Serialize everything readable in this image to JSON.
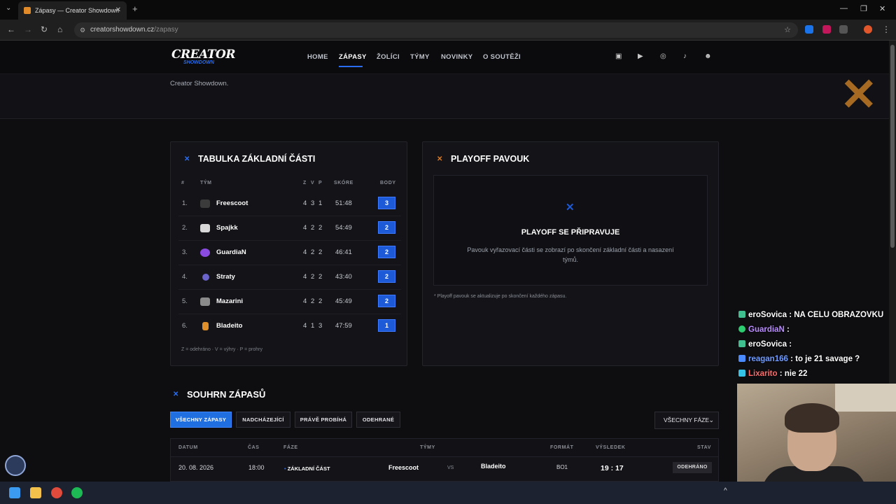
{
  "browser": {
    "tab_title": "Zápasy — Creator Showdown",
    "url_host": "creatorshowdown.cz",
    "url_path": "/zapasy"
  },
  "site": {
    "logo": "CREATOR",
    "logo_sub": "SHOWDOWN",
    "nav": [
      "HOME",
      "ZÁPASY",
      "ŽOLÍCI",
      "TÝMY",
      "NOVINKY",
      "O SOUTĚŽI"
    ],
    "active_nav": "ZÁPASY",
    "social_icons": [
      "twitch-icon",
      "youtube-icon",
      "instagram-icon",
      "tiktok-icon",
      "discord-icon"
    ],
    "hero_text": "Creator Showdown."
  },
  "standings": {
    "title": "TABULKA ZÁKLADNÍ ČÁSTI",
    "headers": {
      "rank": "#",
      "team": "TÝM",
      "z": "Z",
      "v": "V",
      "p": "P",
      "score": "SKÓRE",
      "points": "BODY"
    },
    "rows": [
      {
        "rank": "1.",
        "team": "Freescoot",
        "z": "4",
        "v": "3",
        "p": "1",
        "score": "51:48",
        "points": "3"
      },
      {
        "rank": "2.",
        "team": "Spajkk",
        "z": "4",
        "v": "2",
        "p": "2",
        "score": "54:49",
        "points": "2"
      },
      {
        "rank": "3.",
        "team": "GuardiaN",
        "z": "4",
        "v": "2",
        "p": "2",
        "score": "46:41",
        "points": "2"
      },
      {
        "rank": "4.",
        "team": "Straty",
        "z": "4",
        "v": "2",
        "p": "2",
        "score": "43:40",
        "points": "2"
      },
      {
        "rank": "5.",
        "team": "Mazarini",
        "z": "4",
        "v": "2",
        "p": "2",
        "score": "45:49",
        "points": "2"
      },
      {
        "rank": "6.",
        "team": "Bladeito",
        "z": "4",
        "v": "1",
        "p": "3",
        "score": "47:59",
        "points": "1"
      }
    ],
    "legend": "Z = odehráno · V = výhry · P = prohry"
  },
  "playoff": {
    "title": "PLAYOFF PAVOUK",
    "heading": "PLAYOFF SE PŘIPRAVUJE",
    "description": "Pavouk vyřazovací části se zobrazí po skončení základní části a nasazení týmů.",
    "note": "* Playoff pavouk se aktualizuje po skončení každého zápasu."
  },
  "summary": {
    "title": "SOUHRN ZÁPASŮ",
    "filters": [
      "VŠECHNY ZÁPASY",
      "NADCHÁZEJÍCÍ",
      "PRÁVĚ PROBÍHÁ",
      "ODEHRANÉ"
    ],
    "active_filter": "VŠECHNY ZÁPASY",
    "phase_select": "VŠECHNY FÁZE",
    "headers": {
      "date": "DATUM",
      "time": "ČAS",
      "phase": "FÁZE",
      "teams": "TÝMY",
      "format": "FORMÁT",
      "result": "VÝSLEDEK",
      "status": "STAV"
    },
    "matches": [
      {
        "date": "20. 08. 2026",
        "time": "18:00",
        "phase": "ZÁKLADNÍ ČÁST",
        "home": "Freescoot",
        "vs": "VS",
        "away": "Bladeito",
        "format": "BO1",
        "result": "19 : 17",
        "status": "ODEHRÁNO"
      }
    ]
  },
  "chat": [
    {
      "user": "eroSovica",
      "message": ": NA CELU OBRAZOVKU",
      "user_color": "#ffffff"
    },
    {
      "user": "GuardiaN",
      "message": ":",
      "user_color": "#b98cff"
    },
    {
      "user": "eroSovica",
      "message": ":",
      "user_color": "#ffffff"
    },
    {
      "user": "reagan166",
      "message": ": to je 21 savage ?",
      "user_color": "#6f9bff"
    },
    {
      "user": "Lixarito",
      "message": ": nie 22",
      "user_color": "#ff6b6b"
    }
  ],
  "colors": {
    "accent": "#1d5ad8",
    "orange": "#e07a1f"
  }
}
